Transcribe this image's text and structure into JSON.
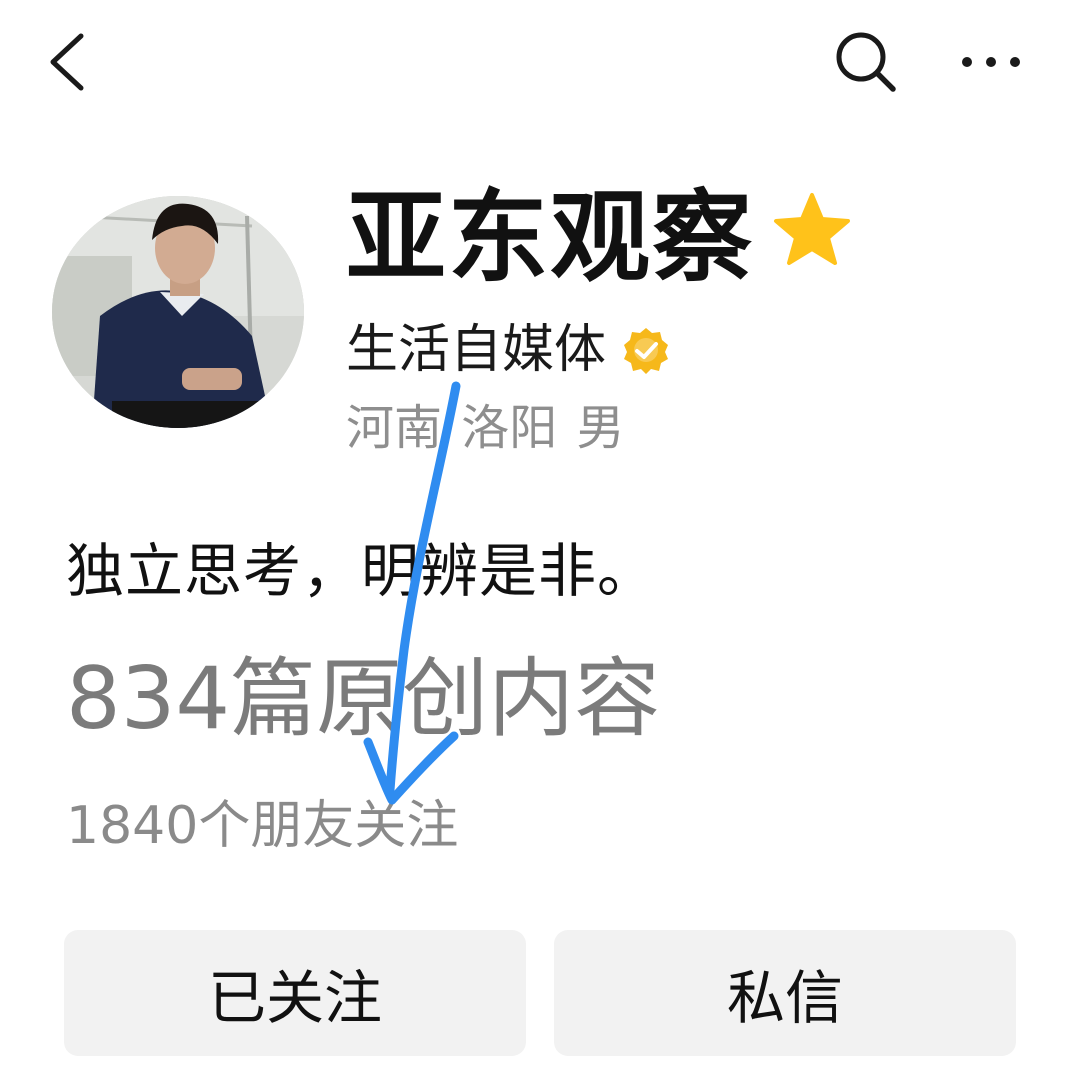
{
  "header": {
    "back_icon": "chevron-left-icon",
    "search_icon": "search-icon",
    "more_icon": "more-horizontal-icon"
  },
  "profile": {
    "name": "亚东观察",
    "badge_icon": "star-icon",
    "badge_color": "#FFC21A",
    "certification": "生活自媒体",
    "verified_icon": "verified-badge-icon",
    "location": "河南 洛阳 男",
    "bio": "独立思考，明辨是非。",
    "stats": "834篇原创内容",
    "followers": "1840个朋友关注"
  },
  "actions": {
    "follow_label": "已关注",
    "message_label": "私信"
  },
  "annotation_color": "#2F8CF0"
}
